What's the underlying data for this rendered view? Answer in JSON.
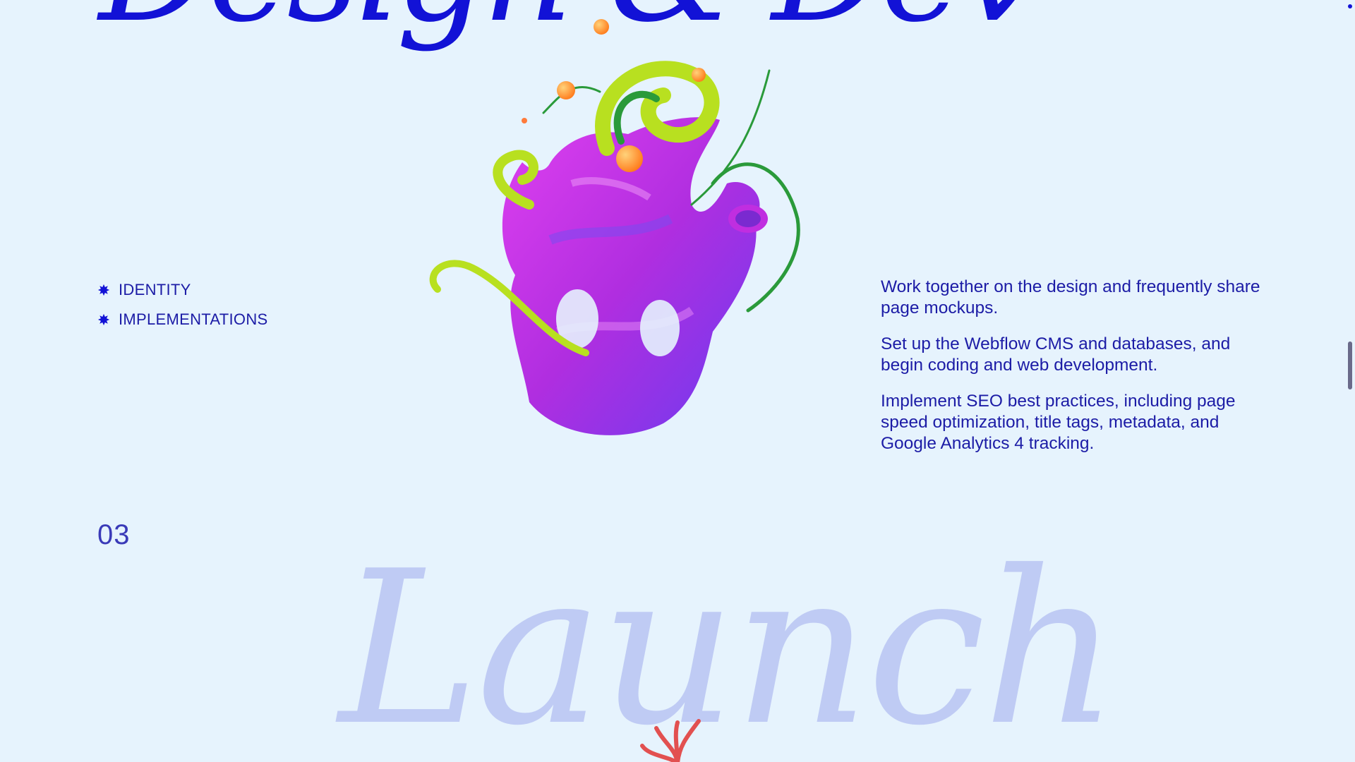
{
  "hero": {
    "title": "Design & Dev"
  },
  "services": {
    "items": [
      {
        "label": "IDENTITY",
        "icon": "starburst-bullet-icon"
      },
      {
        "label": "IMPLEMENTATIONS",
        "icon": "starburst-bullet-icon"
      }
    ]
  },
  "description": {
    "paragraphs": [
      "Work together on the design and frequently share page mockups.",
      "Set up the Webflow CMS and databases, and begin coding and web development.",
      "Implement SEO best practices, including page speed optimization, title tags, metadata, and Google Analytics 4 tracking."
    ]
  },
  "next_step": {
    "number": "03",
    "title": "Launch"
  },
  "colors": {
    "background": "#e6f3fd",
    "accent": "#1212d6",
    "text": "#1c1ca6",
    "faded_title": "#bfcbf4",
    "sculpture_purple": "#c02ee0",
    "tendril_green": "#b8e020"
  }
}
